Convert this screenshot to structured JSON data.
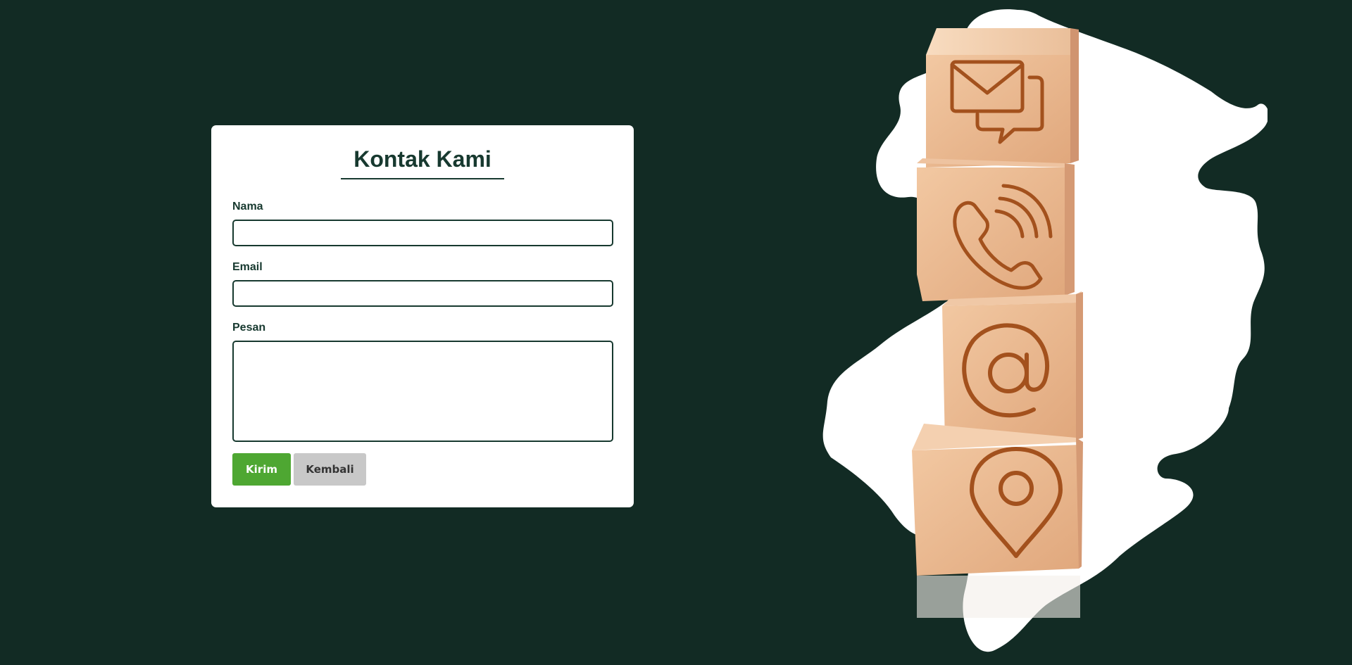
{
  "contact_form": {
    "title": "Kontak Kami",
    "fields": {
      "name_label": "Nama",
      "name_value": "",
      "email_label": "Email",
      "email_value": "",
      "message_label": "Pesan",
      "message_value": ""
    },
    "buttons": {
      "submit_label": "Kirim",
      "back_label": "Kembali"
    }
  },
  "illustration": {
    "icons": [
      "envelope-chat-icon",
      "phone-icon",
      "at-sign-icon",
      "location-pin-icon"
    ]
  },
  "colors": {
    "background": "#122b24",
    "accent_dark": "#17392f",
    "submit_button": "#4ea732",
    "back_button": "#c8c8c8"
  }
}
